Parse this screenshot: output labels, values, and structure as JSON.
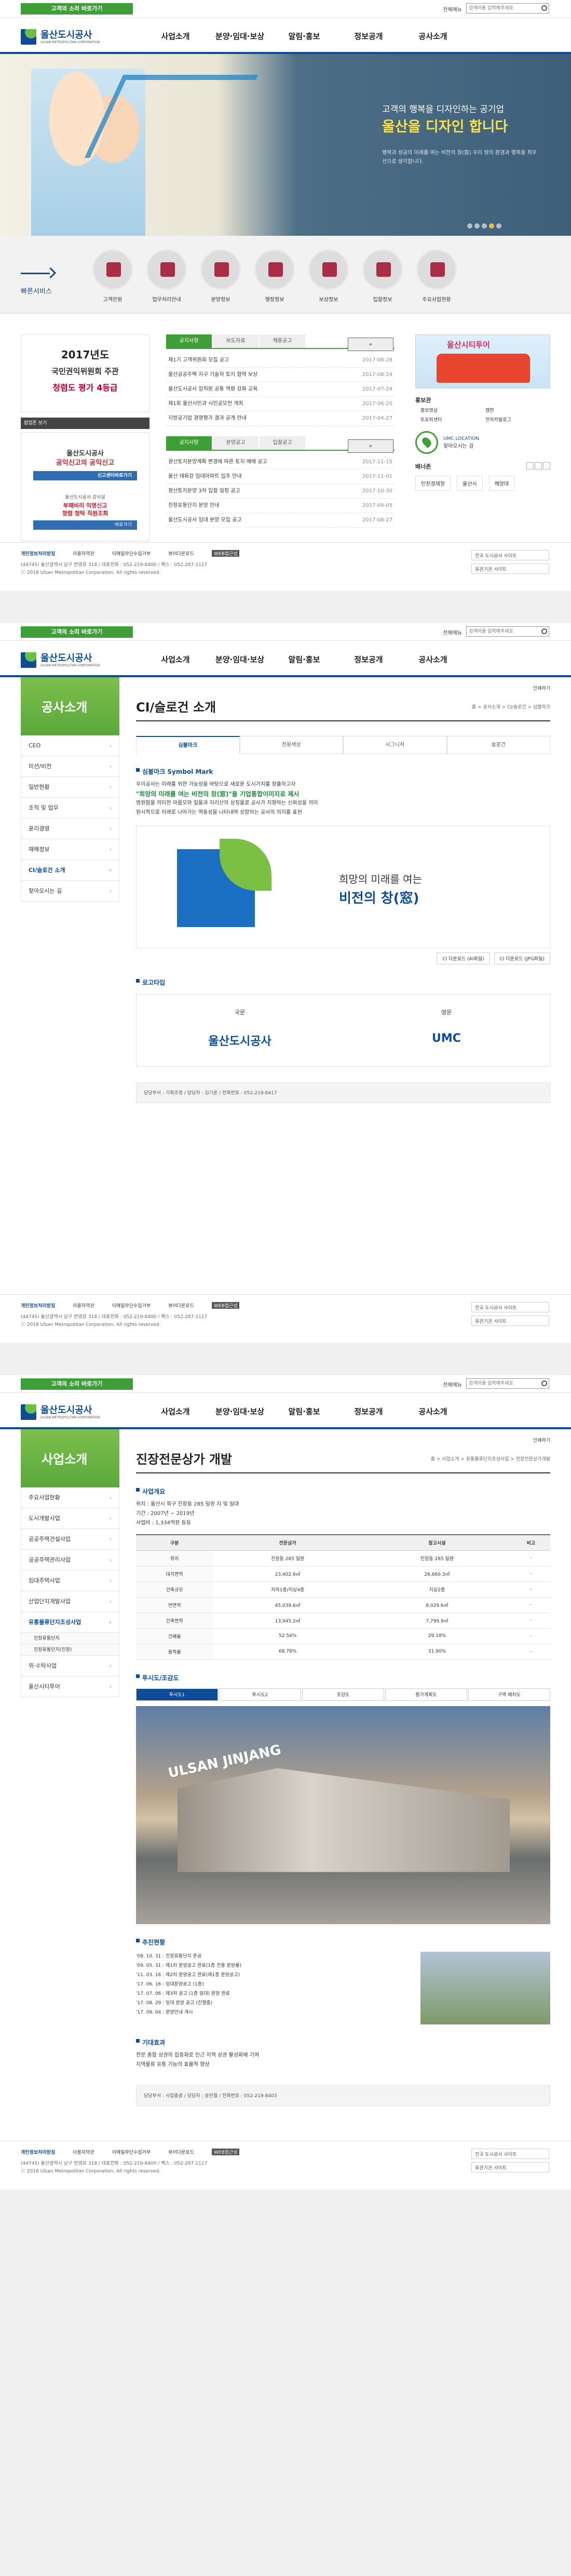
{
  "top": {
    "voice": "고객의 소리 바로가기",
    "sitemap": "전체메뉴",
    "search_placeholder": "검색어를 입력해주세요"
  },
  "logo": {
    "kr": "울산도시공사",
    "en": "ULSAN METROPOLITAN CORPORATION"
  },
  "gnb": [
    "사업소개",
    "분양·임대·보상",
    "알림·홍보",
    "정보공개",
    "공사소개"
  ],
  "hero": {
    "line1": "고객의 행복을 디자인하는 공기업",
    "line2": "울산을 디자인 합니다",
    "desc": "행복과 성공의 미래를 여는 비전의 창(窓) 우리 땅의 환경과 행복을 최우선으로 생각합니다."
  },
  "quick": {
    "title": "빠른서비스",
    "items": [
      "고객만원",
      "업무처리안내",
      "분양정보",
      "행정정보",
      "보상정보",
      "입찰정보",
      "주요사업현황"
    ]
  },
  "eval": {
    "year": "2017년도",
    "line": "국민권익위원회 주관",
    "hl": "청렴도 평가 4등급"
  },
  "popup": {
    "bar": "팝업존 보기",
    "a1": "울산도시공사",
    "a2": "공익신고의 공익신고",
    "btn": "신고센터바로가기",
    "b1": "울산도시공사 감사실",
    "b2": "부패비리 익명신고",
    "b3": "청렴 청탁 직원조회",
    "btn2": "바로가기"
  },
  "news": {
    "tabs": [
      "공지사항",
      "보도자료",
      "채용공고"
    ],
    "items": [
      [
        "제1기 고객위원회 모집 공고",
        "2017-08-28"
      ],
      [
        "울산공공주택 지구 기술자 토지 협약 보상",
        "2017-08-24"
      ],
      [
        "울산도시공사 임직원 공통 역량 강화 교육",
        "2017-07-24"
      ],
      [
        "제1회 울산시민과 시민공모전 개최",
        "2017-06-20"
      ],
      [
        "지방공기업 경영평가 결과 공개 안내",
        "2017-04-27"
      ]
    ],
    "tabs2": [
      "공지사항",
      "분양공고",
      "입찰공고"
    ],
    "items2": [
      [
        "광산토지분양계획 변경에 따른 토지 매매 공고",
        "2017-11-15"
      ],
      [
        "울산 태화강 임대아파트 입주 안내",
        "2017-11-01"
      ],
      [
        "광산토지분양 3차 입찰 일정 공고",
        "2017-10-30"
      ],
      [
        "진장유통단지 분양 안내",
        "2017-09-05"
      ],
      [
        "울산도시공사 임대 분양 모집 공고",
        "2017-08-27"
      ]
    ]
  },
  "right": {
    "bus": "울산시티투어",
    "hb": "홍보관",
    "hb_items": [
      "홍보영상",
      "캠현",
      "트로피센터",
      "전자카탈로그"
    ],
    "loc1": "UMC LOCATION",
    "loc2": "찾아오시는 길",
    "banner": "배너존",
    "bnrs": [
      "인천경제청",
      "울산시",
      "해양대"
    ]
  },
  "footer": {
    "links": [
      "개인정보처리방침",
      "이용자약관",
      "이메일무단수집거부",
      "뷰어다운로드"
    ],
    "wa": "WEB접근성",
    "addr": "(44745) 울산광역시 남구 번영로 318 / 대표전화 : 052-219-8400 / 팩스 : 052-287-1117",
    "copy": "ⓒ 2018 Ulsan Metropolitan Corporation. All rights reserved.",
    "sel1": "전국 도시공사 사이트",
    "sel2": "유관기관 사이트"
  },
  "sub1": {
    "lnb": "공사소개",
    "menu": [
      "CEO",
      "미션/비전",
      "일반현황",
      "조직 및 업무",
      "윤리경영",
      "재해정보",
      "CI/슬로건 소개",
      "찾아오시는 길"
    ],
    "print": "인쇄하기",
    "title": "CI/슬로건 소개",
    "crumb": "홈 > 공사소개 > CI/슬로건 > 심볼마크",
    "tabs": [
      "심볼마크",
      "전용색상",
      "시그니처",
      "슬로건"
    ],
    "h1": "심볼마크 Symbol Mark",
    "p1": "우리공사는 미래를 위한 가능성을 바탕으로 새로운 도시가치를 창출하고자",
    "slogan": "\"희망의 미래를 여는 비전의 창(窓)\"을 기업통합이미지로 제시",
    "b1": "영원함을 의미한 마름모와 밀물과 지리산의 상징물로 공사가 지향하는 신뢰성을 의미",
    "b2": "원시적으로 미래로 나아가는 역동성을 나타내며 성장하는 공사의 의지를 표현",
    "ci1": "희망의 미래를 여는",
    "ci2": "비전의 창(窓)",
    "dl": [
      "CI 다운로드 (AI파일)",
      "CI 다운로드 (JPG파일)"
    ],
    "h2": "로고타입",
    "kr": "국문",
    "krv": "울산도시공사",
    "en": "영문",
    "env": "UMC",
    "staff": "담당부서 : 기획조정 / 담당자 : 김기운 / 전화번호 : 052-219-8417"
  },
  "sub2": {
    "lnb": "사업소개",
    "menu": [
      "주요사업현황",
      "도시개발사업",
      "공공주택건설사업",
      "공공주택관리사업",
      "임대주택사업",
      "산업단지개발사업",
      "유통물류단지조성사업"
    ],
    "children": [
      "진장유통단지",
      "진장유통단지(진장)"
    ],
    "menu2": [
      "위·수탁사업",
      "울산시티투어"
    ],
    "title": "진장전문상가 개발",
    "crumb": "홈 > 사업소개 > 유통물류단지조성사업 > 진장전문상가개발",
    "h1": "사업개요",
    "p": [
      "위치 : 울산시 북구 진장동 285 일원 지 및 일대",
      "기간 : 2007년 ~ 2019년",
      "사업비 : 1,334억원 등등"
    ],
    "th": [
      "구분",
      "전문상가",
      "창고시설",
      "비고"
    ],
    "rows": [
      [
        "위치",
        "진장동 285 일원",
        "진장동 285 일원",
        "-"
      ],
      [
        "대지면적",
        "23,402.6㎡",
        "26,660.3㎡",
        "-"
      ],
      [
        "건축규모",
        "지하1층/지상4층",
        "지상2층",
        "-"
      ],
      [
        "연면적",
        "45,039.6㎡",
        "8,029.6㎡",
        "-"
      ],
      [
        "건축면적",
        "13,945.2㎡",
        "7,799.9㎡",
        "-"
      ],
      [
        "건폐율",
        "52.54%",
        "29.18%",
        "-"
      ],
      [
        "용적률",
        "68.78%",
        "31.90%",
        "-"
      ]
    ],
    "h2": "투시도/조감도",
    "ptabs": [
      "투시도1",
      "투시도2",
      "조감도",
      "평가계획도",
      "구역 배치도"
    ],
    "bld": "ULSAN JINJANG",
    "h3": "추진현황",
    "prog": [
      "'08. 10. 31 : 진장유통단지 준공",
      "'09. 05. 31 : 제1차 분양공고 완료(1층 전용 분양률)",
      "'11. 03. 16 : 제2차 분양공고 완료(제1층 분양공고)",
      "'17. 06. 16 : 임대분양공고 (1층)",
      "'17. 07. 06 : 제3차 공고 (1층 임대) 분양 완료",
      "'17. 08. 29 : 임대 분양 공고 (진행중)",
      "'17. 09. 04 : 분양안내 개시"
    ],
    "h4": "기대효과",
    "eff": [
      "전문 종합 상권의 집중화로 인근 지역 상권 활성화에 기여",
      "지역물류 유통 기능의 효율적 향상"
    ],
    "staff": "담당부서 : 사업총괄 / 담당자 : 송민철 / 전화번호 : 052-219-8403"
  }
}
